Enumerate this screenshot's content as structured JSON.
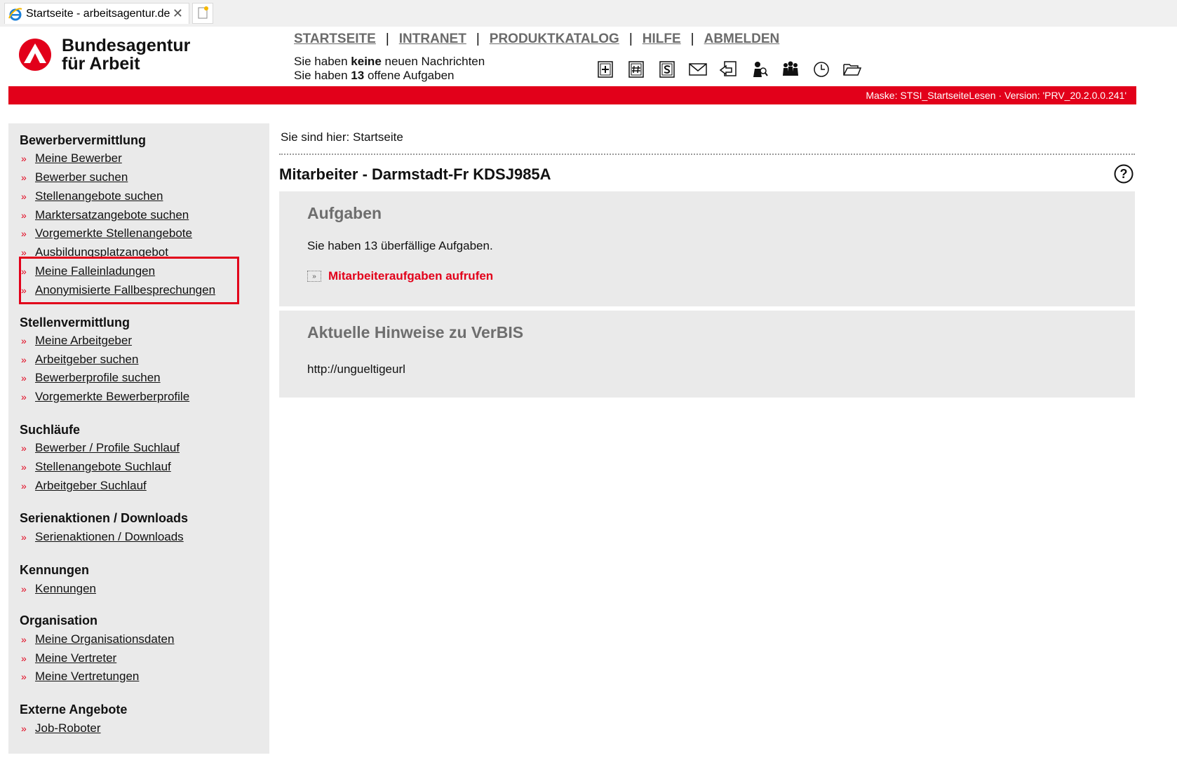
{
  "browser": {
    "tab_title": "Startseite - arbeitsagentur.de",
    "close_glyph": "✕"
  },
  "brand": {
    "line1": "Bundesagentur",
    "line2": "für Arbeit"
  },
  "topnav": {
    "items": [
      "STARTSEITE",
      "INTRANET",
      "PRODUKTKATALOG",
      "HILFE",
      "ABMELDEN"
    ],
    "separator": "|"
  },
  "messages": {
    "line1_prefix": "Sie haben ",
    "line1_bold": "keine",
    "line1_suffix": " neuen Nachrichten",
    "line2_prefix": "Sie haben ",
    "line2_bold": "13",
    "line2_suffix": " offene Aufgaben"
  },
  "toolbar_icons": [
    "add-document-icon",
    "number-document-icon",
    "s-document-icon",
    "mail-icon",
    "forward-document-icon",
    "person-search-icon",
    "group-icon",
    "clock-icon",
    "folder-open-icon"
  ],
  "status_bar": {
    "text": "Maske: STSI_StartseiteLesen · Version: 'PRV_20.2.0.0.241'"
  },
  "sidebar": {
    "chevron": "»",
    "sections": [
      {
        "title": "Bewerbervermittlung",
        "items": [
          "Meine Bewerber",
          "Bewerber suchen",
          "Stellenangebote suchen",
          "Marktersatzangebote suchen",
          "Vorgemerkte Stellenangebote",
          "Ausbildungsplatzangebot",
          "Meine Falleinladungen",
          "Anonymisierte Fallbesprechungen"
        ]
      },
      {
        "title": "Stellenvermittlung",
        "items": [
          "Meine Arbeitgeber",
          "Arbeitgeber suchen",
          "Bewerberprofile suchen",
          "Vorgemerkte Bewerberprofile"
        ]
      },
      {
        "title": "Suchläufe",
        "items": [
          "Bewerber / Profile Suchlauf",
          "Stellenangebote Suchlauf",
          "Arbeitgeber Suchlauf"
        ]
      },
      {
        "title": "Serienaktionen / Downloads",
        "items": [
          "Serienaktionen / Downloads"
        ]
      },
      {
        "title": "Kennungen",
        "items": [
          "Kennungen"
        ]
      },
      {
        "title": "Organisation",
        "items": [
          "Meine Organisationsdaten",
          "Meine Vertreter",
          "Meine Vertretungen"
        ]
      },
      {
        "title": "Externe Angebote",
        "items": [
          "Job-Roboter"
        ]
      }
    ]
  },
  "main": {
    "breadcrumb": "Sie sind hier: Startseite",
    "title": "Mitarbeiter - Darmstadt-Fr KDSJ985A",
    "help_glyph": "?",
    "tasks": {
      "heading": "Aufgaben",
      "text": "Sie haben 13 überfällige Aufgaben.",
      "link": "Mitarbeiteraufgaben aufrufen",
      "link_glyph": "»"
    },
    "notices": {
      "heading": "Aktuelle Hinweise zu VerBIS",
      "text": "http://ungueltigeurl"
    }
  },
  "colors": {
    "brand_red": "#e2001a",
    "panel_gray": "#eaeaea",
    "heading_gray": "#6e6e6e"
  }
}
